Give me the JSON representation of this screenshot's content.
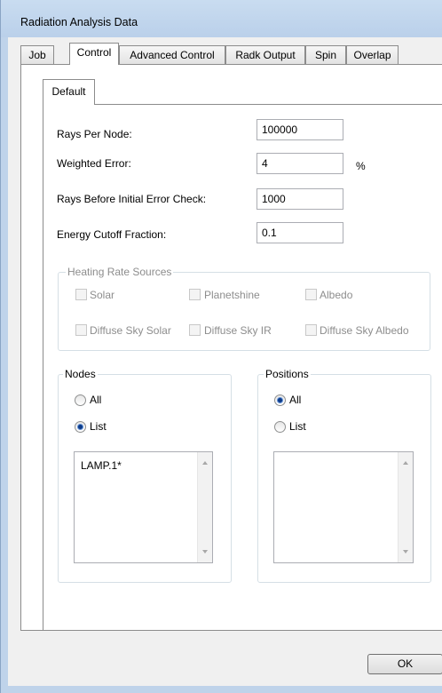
{
  "window": {
    "title": "Radiation Analysis Data"
  },
  "tabs": [
    "Job",
    "Control",
    "Advanced Control",
    "Radk Output",
    "Spin",
    "Overlap"
  ],
  "active_tab": "Control",
  "subtab": {
    "label": "Default"
  },
  "fields": {
    "rays_per_node": {
      "label": "Rays Per Node:",
      "value": "100000"
    },
    "weighted_error": {
      "label": "Weighted Error:",
      "value": "4",
      "unit": "%"
    },
    "rays_before_check": {
      "label": "Rays Before Initial Error Check:",
      "value": "1000"
    },
    "energy_cutoff": {
      "label": "Energy Cutoff Fraction:",
      "value": "0.1"
    }
  },
  "heating": {
    "title": "Heating Rate Sources",
    "solar": "Solar",
    "planetshine": "Planetshine",
    "albedo": "Albedo",
    "diffuse_solar": "Diffuse Sky Solar",
    "diffuse_ir": "Diffuse Sky IR",
    "diffuse_albedo": "Diffuse Sky Albedo"
  },
  "nodes": {
    "title": "Nodes",
    "all_label": "All",
    "list_label": "List",
    "selected": "List",
    "items": [
      "LAMP.1*"
    ]
  },
  "positions": {
    "title": "Positions",
    "all_label": "All",
    "list_label": "List",
    "selected": "All",
    "items": []
  },
  "buttons": {
    "ok": "OK"
  },
  "colors": {
    "window_frame": "#bfd3ea",
    "radio_dot": "#0d3b88",
    "disabled_text": "#8d8d8d"
  }
}
